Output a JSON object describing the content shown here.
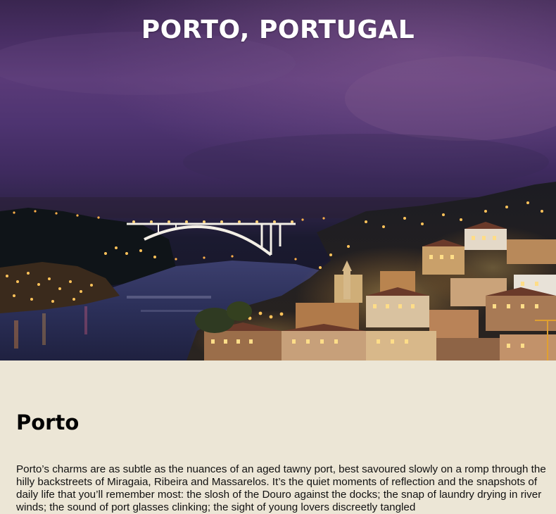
{
  "hero": {
    "title": "PORTO, PORTUGAL",
    "image_alt": "Night view of Porto and the Douro river with the Arrábida bridge"
  },
  "section": {
    "heading": "Porto",
    "body": "Porto’s charms are as subtle as the nuances of an aged tawny port, best savoured slowly on a romp through the hilly backstreets of Miragaia, Ribeira and Massarelos. It’s the quiet moments of reflection and the snapshots of daily life that you’ll remember most: the slosh of the Douro against the docks; the snap of laundry drying in river winds; the sound of port glasses clinking; the sight of young lovers discreetly tangled"
  },
  "colors": {
    "page_background": "#ece6d6",
    "title_color": "#ffffff",
    "sky_purple": "#4e3471",
    "city_lights": "#ffc35a"
  }
}
